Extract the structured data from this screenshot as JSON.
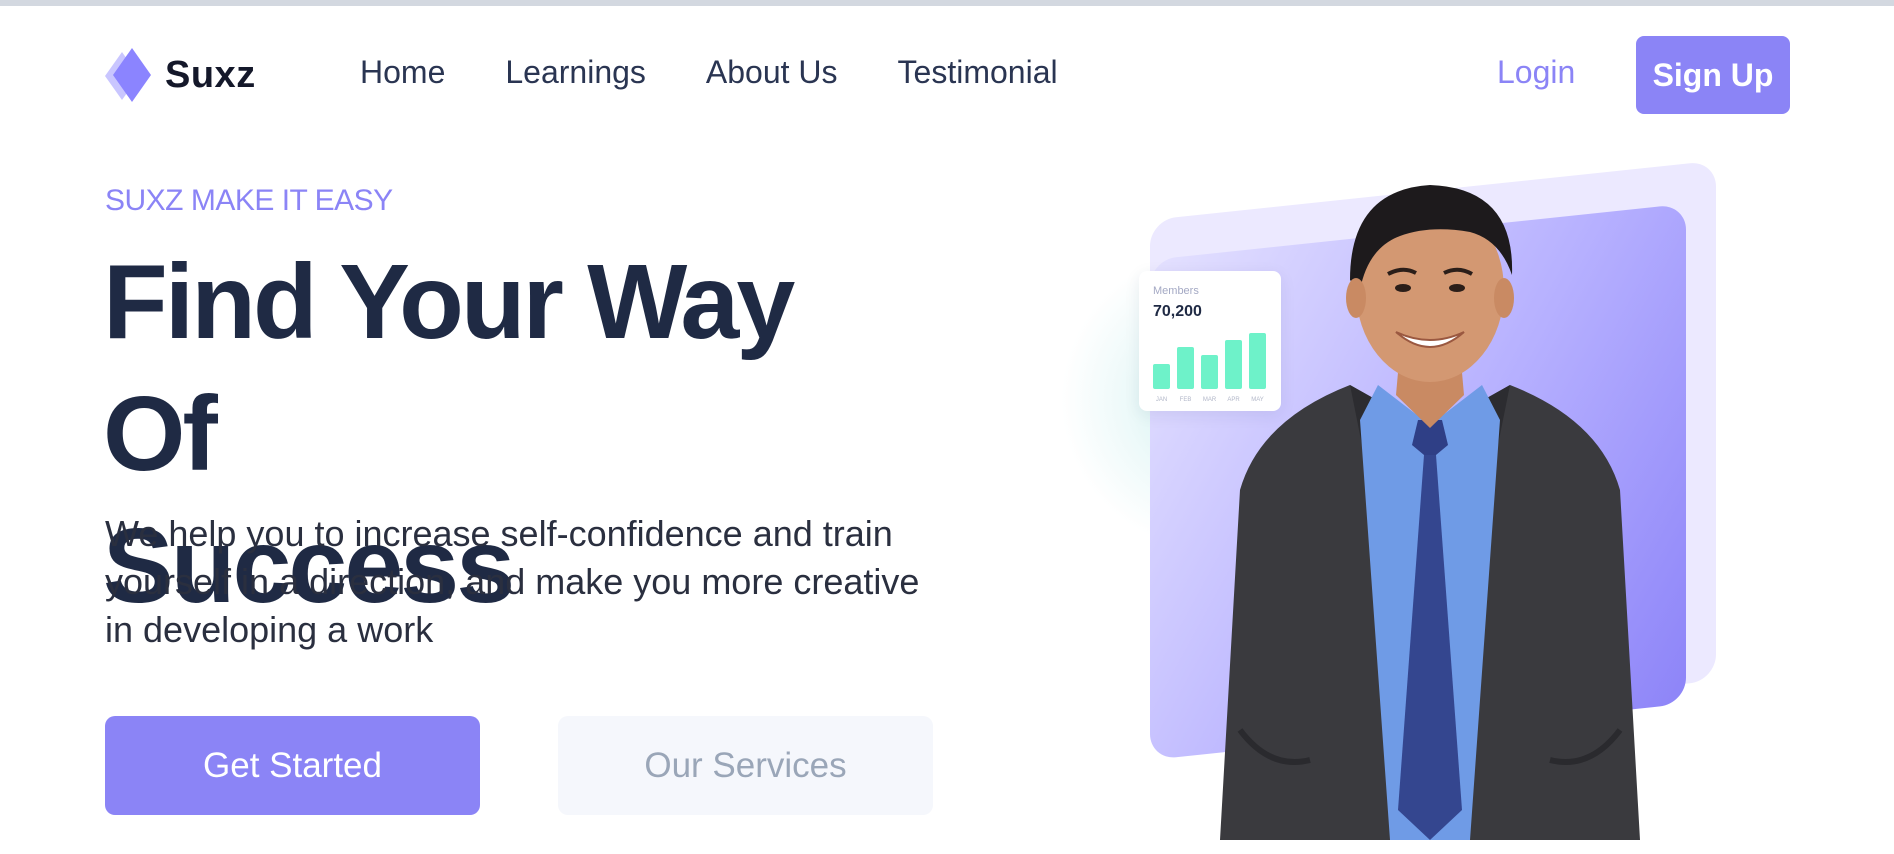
{
  "brand": {
    "name": "Suxz"
  },
  "nav": {
    "items": [
      {
        "label": "Home"
      },
      {
        "label": "Learnings"
      },
      {
        "label": "About Us"
      },
      {
        "label": "Testimonial"
      }
    ],
    "login": "Login",
    "signup": "Sign Up"
  },
  "hero": {
    "eyebrow": "SUXZ MAKE IT EASY",
    "headline_line1": "Find Your Way Of",
    "headline_line2": "Success",
    "description": "We help you to increase self-confidence and train yourself in a direction, and make you more creative in developing a work",
    "primary_cta": "Get Started",
    "secondary_cta": "Our Services"
  },
  "stats_card": {
    "label": "Members",
    "value": "70,200",
    "months": [
      "JAN",
      "FEB",
      "MAR",
      "APR",
      "MAY"
    ],
    "values": [
      0.45,
      0.75,
      0.6,
      0.88,
      1.0
    ]
  },
  "colors": {
    "accent": "#8b84f6",
    "heading": "#1f2a44",
    "bar": "#6ef2c9"
  },
  "icons": {
    "logo": "diamond-logo-icon"
  }
}
